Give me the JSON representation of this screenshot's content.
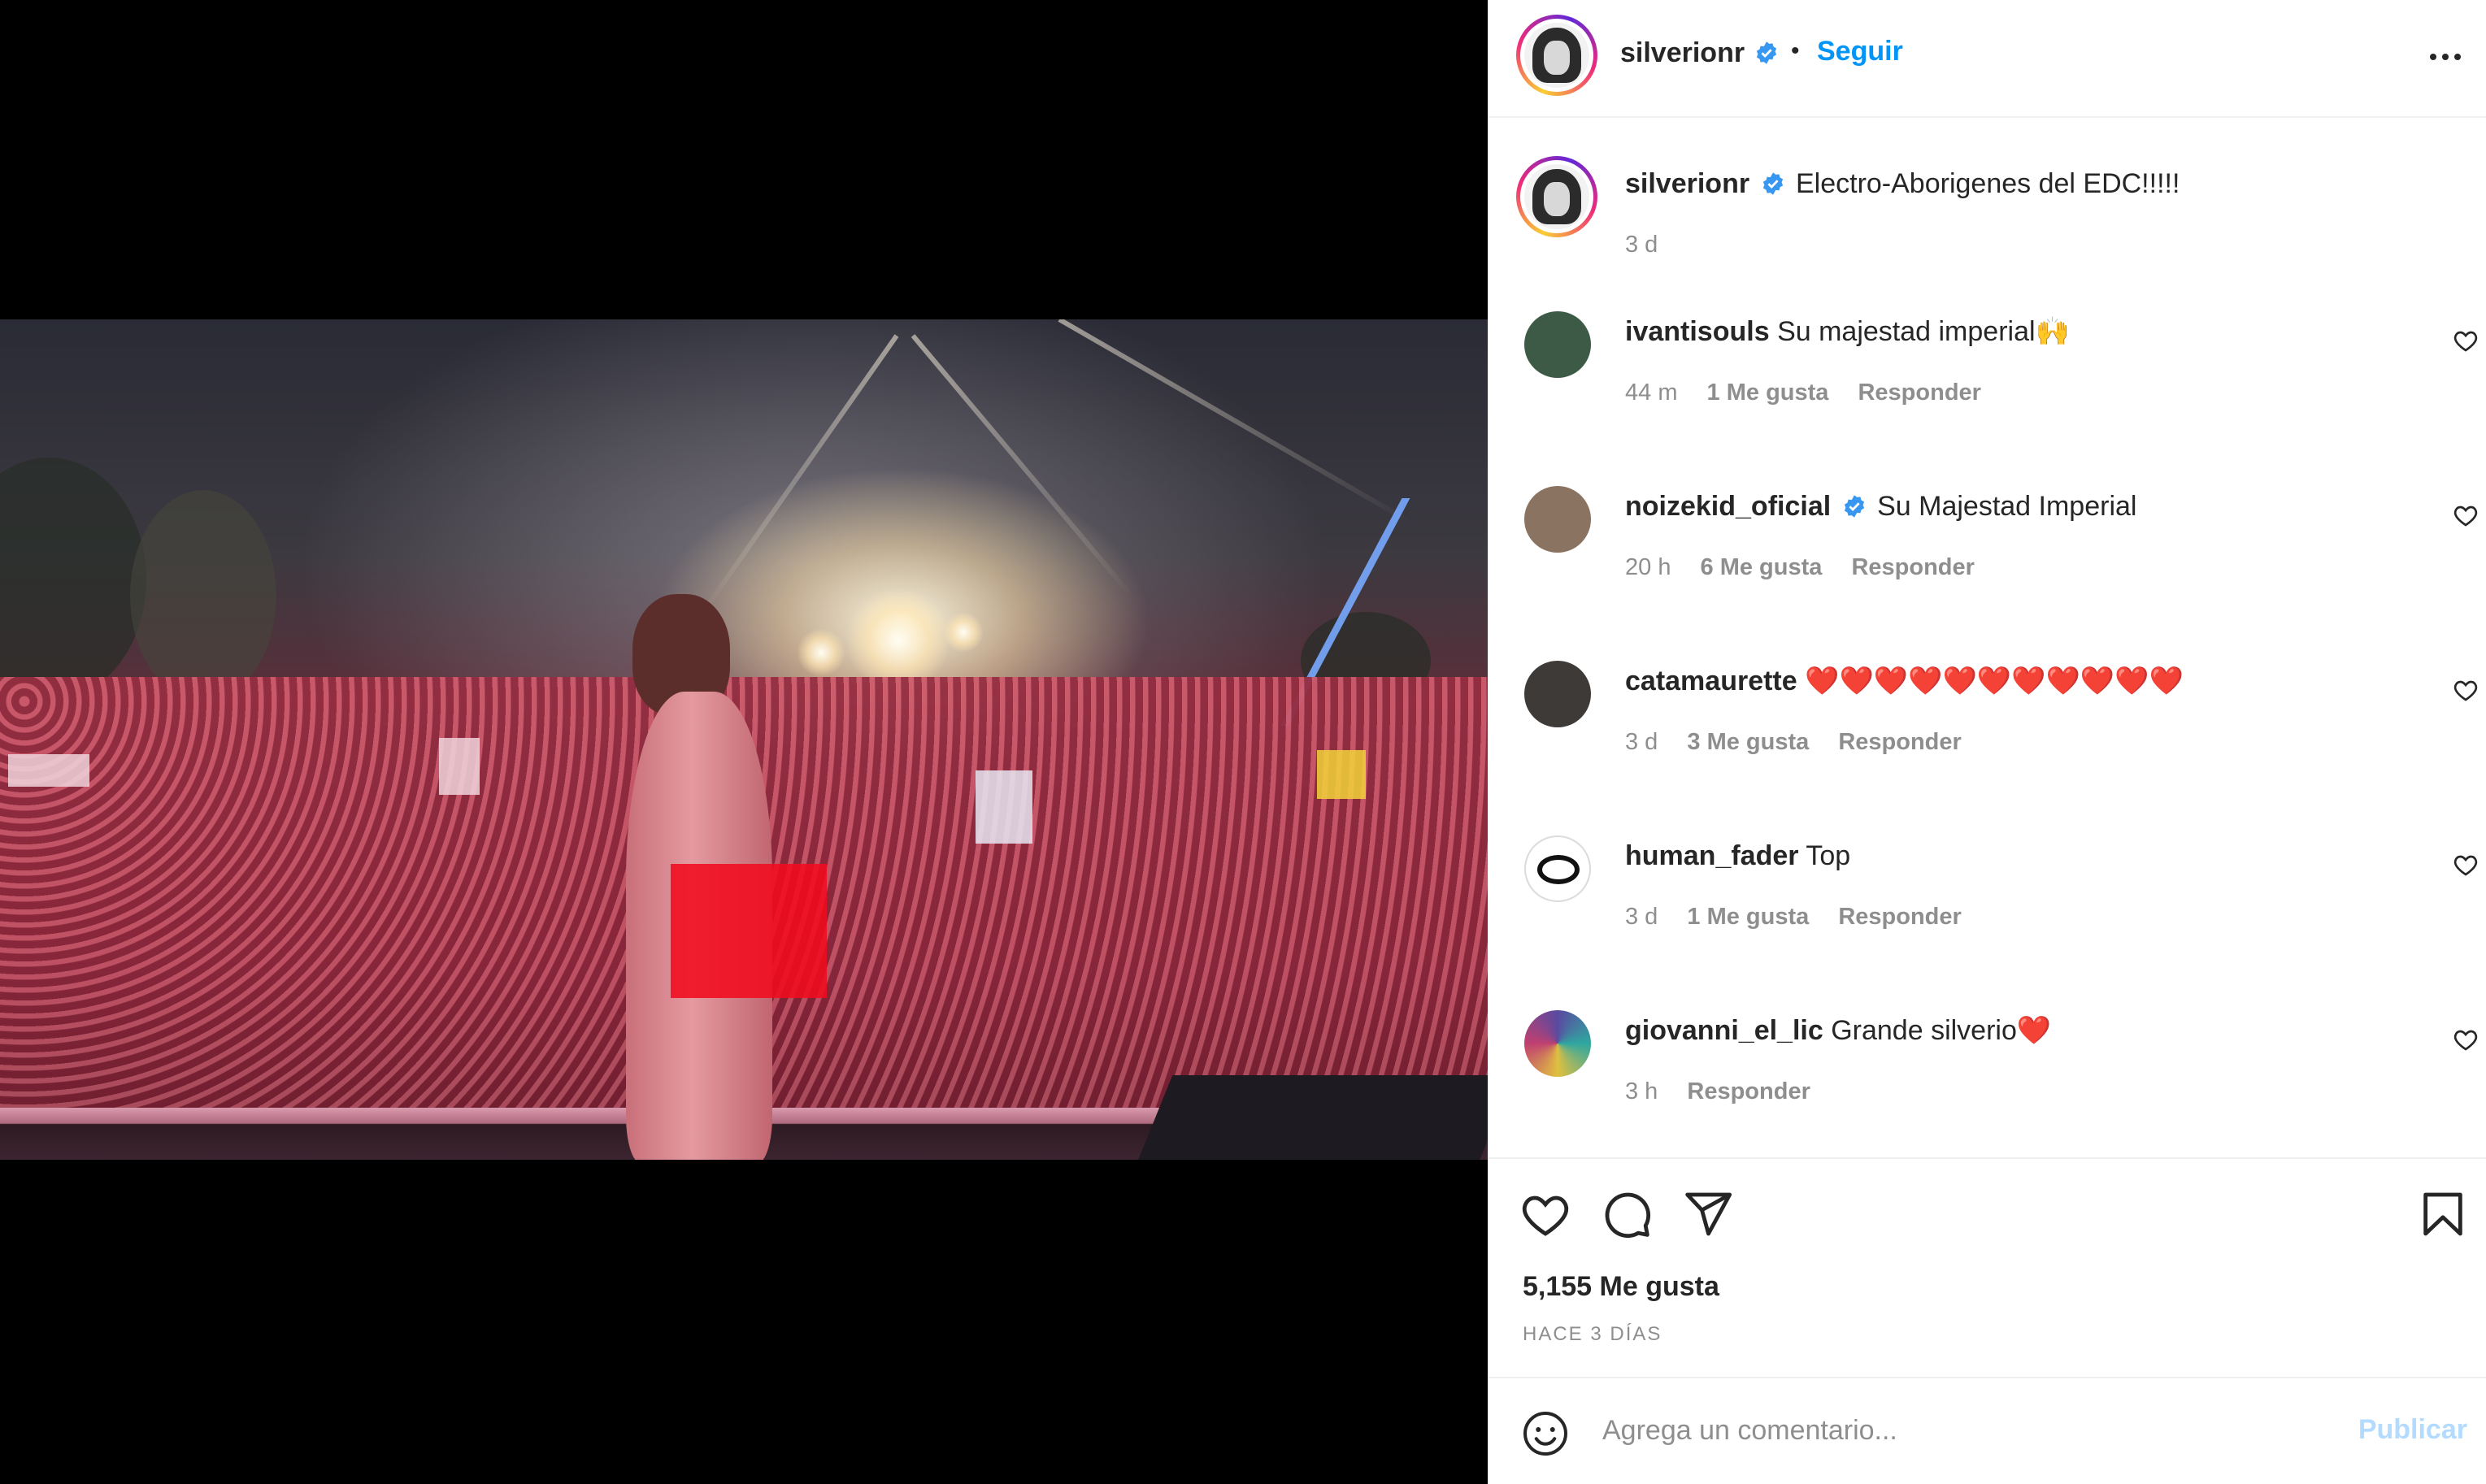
{
  "post": {
    "author": "silverionr",
    "follow_label": "Seguir",
    "separator": "•",
    "media_alt": "Concert stage photo with crowd"
  },
  "caption": {
    "username": "silverionr",
    "text": "Electro-Aborigenes del EDC!!!!!",
    "time": "3 d"
  },
  "comments": [
    {
      "username": "ivantisouls",
      "text": "Su majestad imperial🙌",
      "time": "44 m",
      "likes": "1 Me gusta",
      "reply": "Responder",
      "verified": false,
      "avatar_color": "#3c5a46"
    },
    {
      "username": "noizekid_oficial",
      "text": "Su Majestad Imperial",
      "time": "20 h",
      "likes": "6 Me gusta",
      "reply": "Responder",
      "verified": true,
      "avatar_color": "#8a7360"
    },
    {
      "username": "catamaurette",
      "text": "❤️❤️❤️❤️❤️❤️❤️❤️❤️❤️❤️",
      "time": "3 d",
      "likes": "3 Me gusta",
      "reply": "Responder",
      "verified": false,
      "avatar_color": "#3e3a38"
    },
    {
      "username": "human_fader",
      "text": "Top",
      "time": "3 d",
      "likes": "1 Me gusta",
      "reply": "Responder",
      "verified": false,
      "avatar_color": "#111111"
    },
    {
      "username": "giovanni_el_lic",
      "text": "Grande silverio❤️",
      "time": "3 h",
      "likes": "",
      "reply": "Responder",
      "verified": false,
      "avatar_color": "#5a4aa0"
    }
  ],
  "actions": {
    "likes_count": "5,155 Me gusta",
    "posted_ago": "HACE 3 DÍAS"
  },
  "composer": {
    "placeholder": "Agrega un comentario...",
    "publish_label": "Publicar"
  },
  "colors": {
    "accent": "#0095f6",
    "publish_disabled": "#b3dbff",
    "censor": "#f10b1e"
  },
  "icons": [
    "more-options-icon",
    "verified-badge-icon",
    "heart-icon",
    "comment-icon",
    "share-icon",
    "bookmark-icon",
    "emoji-icon"
  ]
}
